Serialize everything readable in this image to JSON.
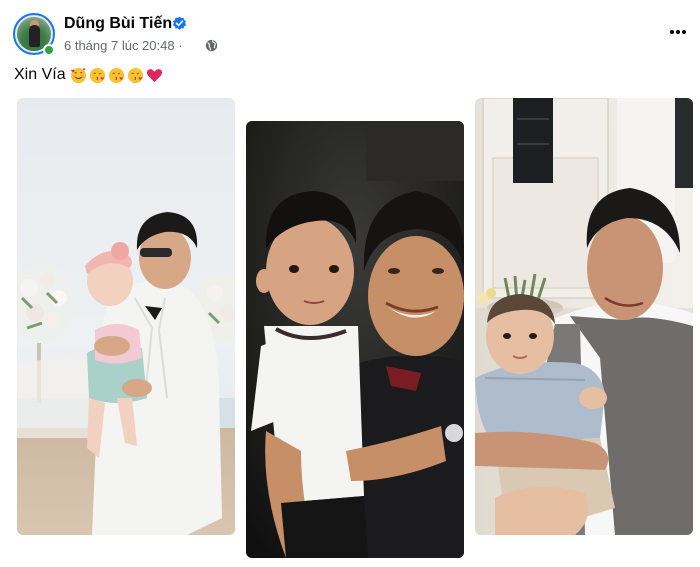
{
  "post": {
    "author": "Dũng Bùi Tiến",
    "timestamp": "6 tháng 7 lúc 20:48 ·",
    "text": "Xin Vía",
    "emojis": [
      "smiling-face-with-hearts",
      "face-blowing-kiss",
      "face-blowing-kiss",
      "face-blowing-kiss",
      "red-heart"
    ]
  },
  "colors": {
    "verified": "#1877f2",
    "online": "#31a24c",
    "meta_text": "#65676b",
    "heart": "#e0245e"
  },
  "icons": {
    "avatar": "profile-photo",
    "verified": "verified-badge-icon",
    "privacy": "globe-icon",
    "more": "more-options-icon"
  },
  "photos": [
    {
      "name": "photo-man-holding-baby-girl-beach"
    },
    {
      "name": "photo-footballer-holding-toddler"
    },
    {
      "name": "photo-man-holding-baby-boy"
    }
  ]
}
